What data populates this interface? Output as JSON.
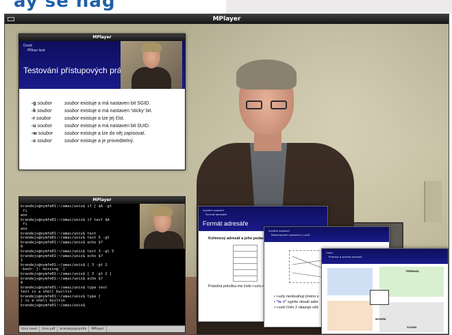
{
  "top_strip": {
    "heading_fragment": "ay se nag"
  },
  "main_window": {
    "title": "MPlayer"
  },
  "slide_window": {
    "title": "MPlayer",
    "breadcrumb": [
      "Úvod",
      "Příkaz test"
    ],
    "heading": "Testování přístupových práv",
    "tests": [
      {
        "opt": "-g",
        "arg": "soubor",
        "desc_arg": "soubor",
        "desc": "existuje a má nastaven bit SGID."
      },
      {
        "opt": "-k",
        "arg": "soubor",
        "desc_arg": "soubor",
        "desc": "existuje a má nastaven 'sticky' bit."
      },
      {
        "opt": "-r",
        "arg": "soubor",
        "desc_arg": "soubor",
        "desc": "existuje a lze jej číst."
      },
      {
        "opt": "-u",
        "arg": "soubor",
        "desc_arg": "soubor",
        "desc": "existuje a má nastaven bit SUID."
      },
      {
        "opt": "-w",
        "arg": "soubor",
        "desc_arg": "soubor",
        "desc": "existuje a lze do něj zapisovat."
      },
      {
        "opt": "-x",
        "arg": "soubor",
        "desc_arg": "soubor",
        "desc": "existuje a je proveditelný."
      }
    ]
  },
  "terminal_window": {
    "title": "MPlayer",
    "lines": [
      "brandejs@nymfe01:~/amac/unix$ if [ $A -gt",
      " fi",
      "ano",
      "brandejs@nymfe01:~/amac/unix$ if test $A",
      " fi",
      "ano",
      "brandejs@nymfe01:~/amac/unix$ test",
      "brandejs@nymfe01:~/amac/unix$ test 5 -gt",
      "brandejs@nymfe01:~/amac/unix$ echo $?",
      "0",
      "brandejs@nymfe01:~/amac/unix$ test 3 -gt 5",
      "brandejs@nymfe01:~/amac/unix$ echo $?",
      "1",
      "brandejs@nymfe01:~/amac/unix$ [ 3 -gt 2",
      "-bash: [: missing `]'",
      "brandejs@nymfe01:~/amac/unix$ [ 3 -gt 2 ]",
      "brandejs@nymfe01:~/amac/unix$ echo $?",
      "0",
      "brandejs@nymfe01:~/amac/unix$ type test",
      "test is a shell builtin",
      "brandejs@nymfe01:~/amac/unix$ type [",
      "[ is a shell builtin",
      "brandejs@nymfe01:~/amac/unix$ "
    ],
    "taskbar": [
      "Unix úvod",
      "Unix.pdf",
      "brandejs@nymfe",
      "MPlayer"
    ]
  },
  "card_adresar": {
    "breadcrumb": [
      "Systém souborů",
      "Formát adresáře"
    ],
    "heading": "Formát adresáře",
    "subheading": "Kořenový adresář a jeho podadresáře",
    "footer": "Prázdná položka má číslo i-uzlu nula."
  },
  "card_iuzly": {
    "breadcrumb": [
      "Systém souborů",
      "Pojmenování souborů a i-uzlů"
    ],
    "bullets": [
      {
        "pre": "i-uzly neobsahují jméno s",
        "key": ""
      },
      {
        "pre": " vypíše obsah adre",
        "key": "\"ls -i\""
      },
      {
        "pre": "i-uzel číslo 2 ukazuje vžd",
        "key": ""
      }
    ]
  },
  "card_procesy": {
    "breadcrumb": [
      "Úvod",
      "Procesy a správa procesů"
    ],
    "labels": [
      "TERMINÁL",
      "MODEM",
      "SOUND"
    ]
  }
}
